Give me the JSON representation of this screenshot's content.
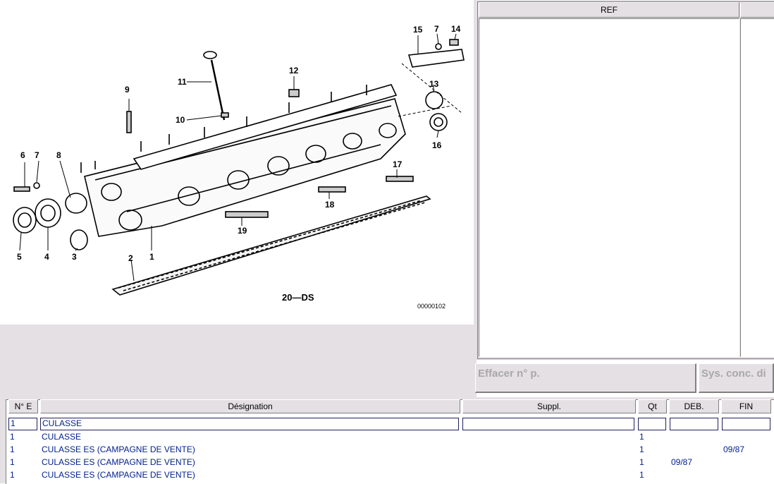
{
  "diagram": {
    "callouts": [
      "1",
      "2",
      "3",
      "4",
      "5",
      "6",
      "7",
      "8",
      "9",
      "10",
      "11",
      "12",
      "13",
      "14",
      "15",
      "16",
      "17",
      "18",
      "19",
      "7"
    ],
    "caption": "20—DS",
    "image_code": "00000102"
  },
  "ref_panel": {
    "col1_header": "REF",
    "col2_header": ""
  },
  "buttons": {
    "clear": "Effacer n° p.",
    "sys": "Sys. conc. di"
  },
  "table": {
    "headers": [
      "N° E",
      "Désignation",
      "Suppl.",
      "Qt",
      "DEB.",
      "FIN"
    ],
    "rows": [
      {
        "ne": "1",
        "designation": "CULASSE",
        "suppl": "",
        "qt": "",
        "deb": "",
        "fin": ""
      },
      {
        "ne": "1",
        "designation": "CULASSE",
        "suppl": "",
        "qt": "1",
        "deb": "",
        "fin": ""
      },
      {
        "ne": "1",
        "designation": "CULASSE ES (CAMPAGNE DE VENTE)",
        "suppl": "",
        "qt": "1",
        "deb": "",
        "fin": "09/87"
      },
      {
        "ne": "1",
        "designation": "CULASSE ES (CAMPAGNE DE VENTE)",
        "suppl": "",
        "qt": "1",
        "deb": "09/87",
        "fin": ""
      },
      {
        "ne": "1",
        "designation": "CULASSE ES (CAMPAGNE DE VENTE)",
        "suppl": "",
        "qt": "1",
        "deb": "",
        "fin": ""
      }
    ]
  }
}
